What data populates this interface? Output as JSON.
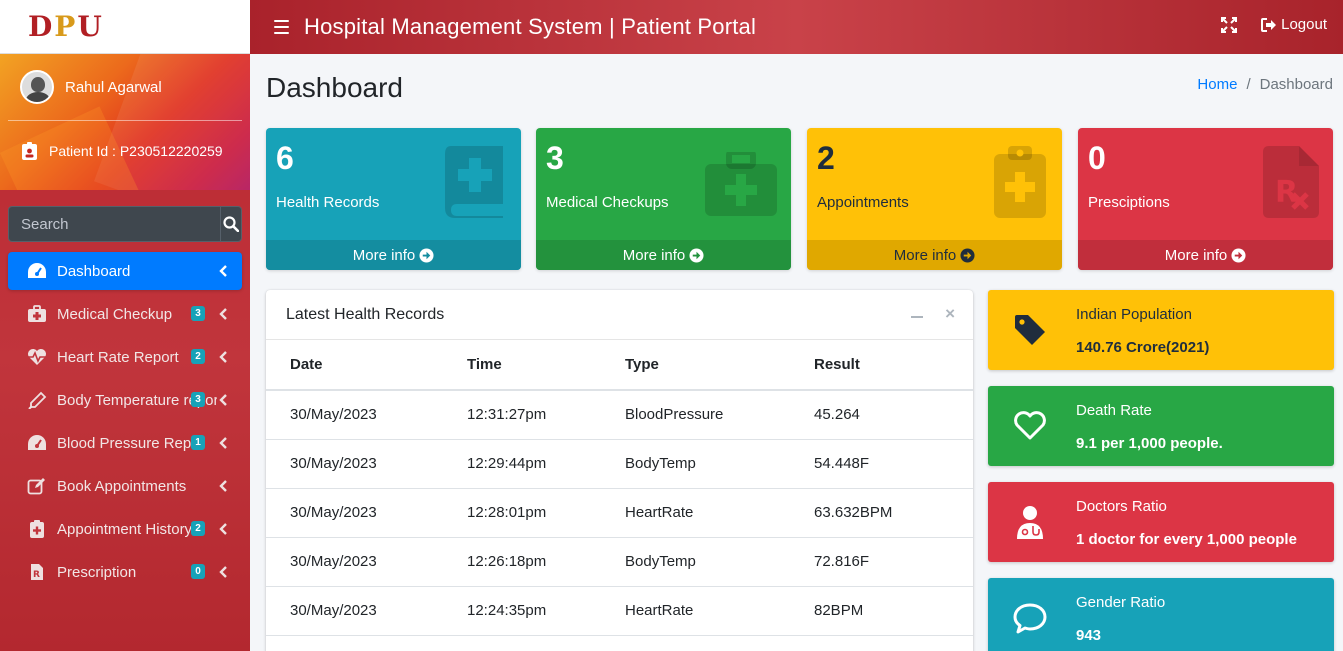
{
  "brand": {
    "logo_text": "DPU"
  },
  "user": {
    "name": "Rahul Agarwal",
    "patient_id": "Patient Id : P230512220259"
  },
  "search": {
    "placeholder": "Search"
  },
  "nav": [
    {
      "label": "Dashboard",
      "badge": null,
      "icon": "tachometer-icon",
      "active": true
    },
    {
      "label": "Medical Checkup",
      "badge": "3",
      "icon": "medkit-icon"
    },
    {
      "label": "Heart Rate Report",
      "badge": "2",
      "icon": "heartbeat-icon"
    },
    {
      "label": "Body Temperature report",
      "badge": "3",
      "icon": "thermometer-icon"
    },
    {
      "label": "Blood Pressure Report",
      "badge": "1",
      "icon": "gauge-icon"
    },
    {
      "label": "Book Appointments",
      "badge": null,
      "icon": "edit-icon"
    },
    {
      "label": "Appointment History",
      "badge": "2",
      "icon": "clipboard-plus-icon"
    },
    {
      "label": "Prescription",
      "badge": "0",
      "icon": "prescription-icon"
    }
  ],
  "topbar": {
    "title": "Hospital Management System | Patient Portal",
    "logout_label": "Logout"
  },
  "page": {
    "title": "Dashboard"
  },
  "breadcrumb": {
    "home": "Home",
    "sep": "/",
    "current": "Dashboard"
  },
  "stat_boxes": [
    {
      "value": "6",
      "label": "Health Records",
      "footer": "More info",
      "color": "#17a2b8",
      "icon": "book-medical-icon"
    },
    {
      "value": "3",
      "label": "Medical Checkups",
      "footer": "More info",
      "color": "#28a745",
      "icon": "briefcase-medical-icon"
    },
    {
      "value": "2",
      "label": "Appointments",
      "footer": "More info",
      "color": "#ffc107",
      "icon": "clipboard-plus-icon"
    },
    {
      "value": "0",
      "label": "Presciptions",
      "footer": "More info",
      "color": "#dc3545",
      "icon": "prescription-file-icon"
    }
  ],
  "records": {
    "title": "Latest Health Records",
    "columns": [
      "Date",
      "Time",
      "Type",
      "Result"
    ],
    "rows": [
      [
        "30/May/2023",
        "12:31:27pm",
        "BloodPressure",
        "45.264"
      ],
      [
        "30/May/2023",
        "12:29:44pm",
        "BodyTemp",
        "54.448F"
      ],
      [
        "30/May/2023",
        "12:28:01pm",
        "HeartRate",
        "63.632BPM"
      ],
      [
        "30/May/2023",
        "12:26:18pm",
        "BodyTemp",
        "72.816F"
      ],
      [
        "30/May/2023",
        "12:24:35pm",
        "HeartRate",
        "82BPM"
      ]
    ]
  },
  "info_boxes": [
    {
      "title": "Indian Population",
      "value": "140.76 Crore(2021)",
      "color": "#ffc107",
      "icon": "tag-icon"
    },
    {
      "title": "Death Rate",
      "value": "9.1 per 1,000 people.",
      "color": "#28a745",
      "icon": "heart-outline-icon"
    },
    {
      "title": "Doctors Ratio",
      "value": "1 doctor for every 1,000 people",
      "color": "#dc3545",
      "icon": "user-doctor-icon"
    },
    {
      "title": "Gender Ratio",
      "value": "943",
      "color": "#17a2b8",
      "icon": "comment-icon"
    }
  ]
}
